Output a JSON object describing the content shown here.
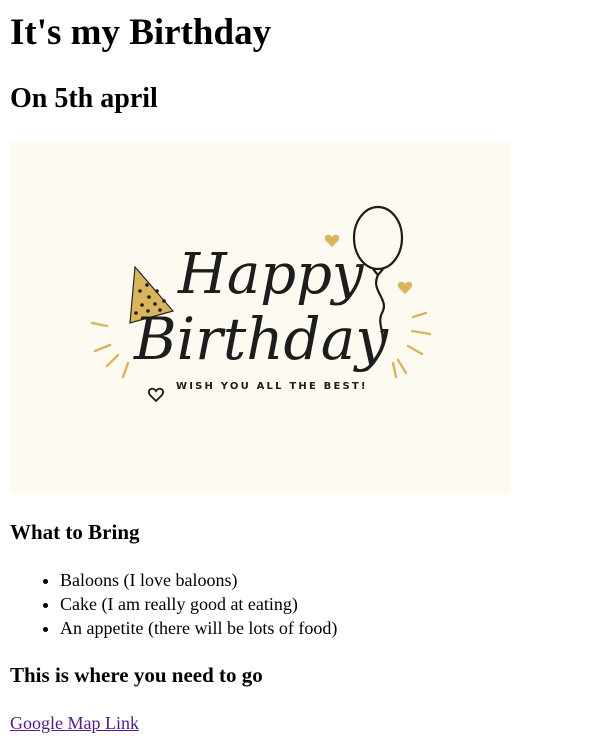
{
  "title": "It's my Birthday",
  "subtitle": "On 5th april",
  "card": {
    "line1": "Happy",
    "line2": "Birthday",
    "tagline": "WISH YOU ALL THE BEST!",
    "accent": "#d9b45a",
    "background": "#fdfaf1"
  },
  "bring": {
    "heading": "What to Bring",
    "items": [
      "Baloons (I love baloons)",
      "Cake (I am really good at eating)",
      "An appetite (there will be lots of food)"
    ]
  },
  "location": {
    "heading": "This is where you need to go",
    "link_text": "Google Map Link"
  }
}
